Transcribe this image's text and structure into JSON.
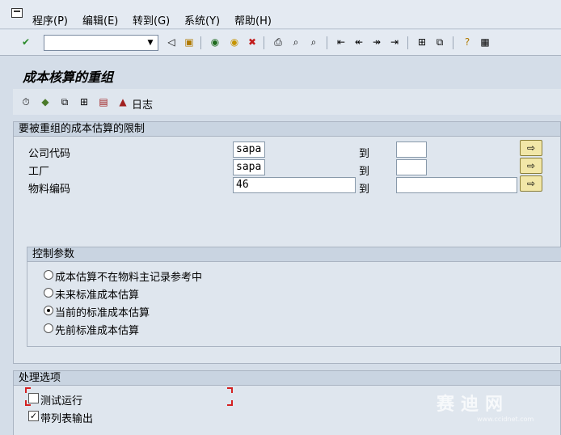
{
  "menu": {
    "items": [
      "程序(P)",
      "编辑(E)",
      "转到(G)",
      "系统(Y)",
      "帮助(H)"
    ]
  },
  "toolbar": {
    "command_value": "",
    "icons": [
      "enter-icon",
      "back-icon",
      "save-icon",
      "green-back-icon",
      "exit-icon",
      "cancel-icon",
      "print-icon",
      "find-icon",
      "find-next-icon",
      "first-page-icon",
      "prev-page-icon",
      "next-page-icon",
      "last-page-icon",
      "new-session-icon",
      "shortcut-icon",
      "help-icon",
      "layout-icon"
    ]
  },
  "title": "成本核算的重组",
  "app_toolbar": {
    "log_label": "日志"
  },
  "selection": {
    "title": "要被重组的成本估算的限制",
    "to_label": "到",
    "rows": [
      {
        "label": "公司代码",
        "from": "sapa",
        "to": ""
      },
      {
        "label": "工厂",
        "from": "sapa",
        "to": ""
      },
      {
        "label": "物料编码",
        "from": "46",
        "to": ""
      }
    ]
  },
  "control": {
    "title": "控制参数",
    "options": [
      {
        "label": "成本估算不在物料主记录参考中",
        "selected": false
      },
      {
        "label": "未来标准成本估算",
        "selected": false
      },
      {
        "label": "当前的标准成本估算",
        "selected": true
      },
      {
        "label": "先前标准成本估算",
        "selected": false
      }
    ]
  },
  "processing": {
    "title": "处理选项",
    "options": [
      {
        "label": "测试运行",
        "checked": false
      },
      {
        "label": "带列表输出",
        "checked": true
      }
    ]
  },
  "watermark": {
    "text": "赛迪网",
    "sub": "www.ccidnet.com"
  }
}
